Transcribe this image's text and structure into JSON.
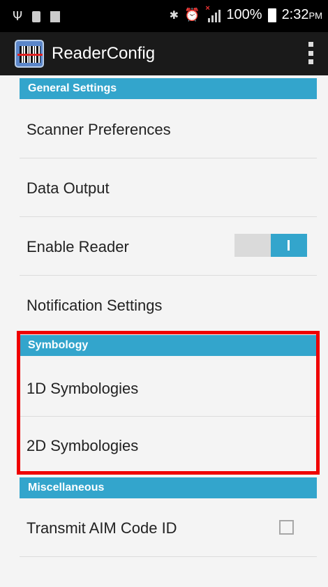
{
  "status_bar": {
    "icons": [
      "usb-icon",
      "sim-icon",
      "storage-icon",
      "bluetooth-icon",
      "alarm-icon",
      "signal-icon",
      "battery-icon"
    ],
    "battery": "100%",
    "time": "2:32",
    "ampm": "PM"
  },
  "app_bar": {
    "title": "ReaderConfig",
    "icon": "barcode-scanner-icon",
    "menu_icon": "overflow-menu-icon"
  },
  "sections": {
    "general": {
      "header": "General Settings",
      "scanner_preferences": "Scanner Preferences",
      "data_output": "Data Output",
      "enable_reader": "Enable Reader",
      "enable_reader_on": true,
      "notification_settings": "Notification Settings"
    },
    "symbology": {
      "header": "Symbology",
      "one_d": "1D Symbologies",
      "two_d": "2D Symbologies"
    },
    "misc": {
      "header": "Miscellaneous",
      "transmit_aim": "Transmit AIM Code ID",
      "transmit_aim_checked": false
    }
  },
  "colors": {
    "accent": "#33a5cc",
    "highlight": "#ef0000",
    "appbar": "#1a1a1a"
  }
}
